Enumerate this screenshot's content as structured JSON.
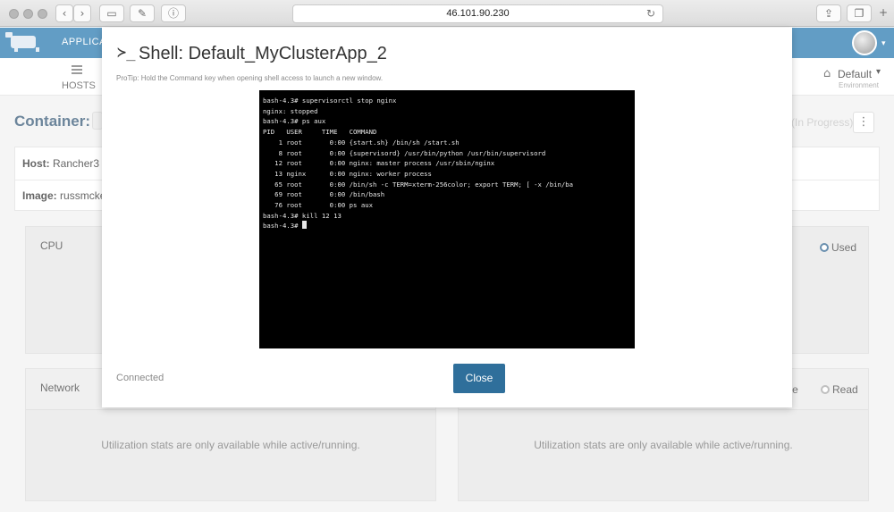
{
  "browser": {
    "url": "46.101.90.230",
    "buttons": {
      "back": "‹",
      "forward": "›",
      "sidebar": "▭",
      "pin": "✎",
      "reader": "ⓘ",
      "reload": "↻",
      "share": "⇪",
      "tabs": "❐",
      "new_tab": "+"
    }
  },
  "app": {
    "nav": {
      "applications_label": "APPLICAT"
    },
    "subnav": {
      "hosts_label": "HOSTS",
      "environment_name": "Default",
      "environment_caption": "Environment"
    },
    "container_label": "Container:",
    "state_text": "(In Progress)",
    "info": {
      "host_label": "Host:",
      "host_value": "Rancher3",
      "image_label": "Image:",
      "image_value": "russmcker"
    },
    "cpu_panel": {
      "title": "CPU",
      "used_label": "Used"
    },
    "network_panel": {
      "title": "Network",
      "message": "Utilization stats are only available while active/running."
    },
    "storage_panel": {
      "write_label": "Write",
      "read_label": "Read",
      "message": "Utilization stats are only available while active/running."
    }
  },
  "modal": {
    "icon": "≻_",
    "title": "Shell: Default_MyClusterApp_2",
    "protip": "ProTip: Hold the Command key when opening shell access to launch a new window.",
    "terminal_lines": [
      "bash-4.3# supervisorctl stop nginx",
      "nginx: stopped",
      "bash-4.3# ps aux",
      "PID   USER     TIME   COMMAND",
      "    1 root       0:00 {start.sh} /bin/sh /start.sh",
      "    8 root       0:00 {supervisord} /usr/bin/python /usr/bin/supervisord",
      "   12 root       0:00 nginx: master process /usr/sbin/nginx",
      "   13 nginx      0:00 nginx: worker process",
      "   65 root       0:00 /bin/sh -c TERM=xterm-256color; export TERM; [ -x /bin/ba",
      "   69 root       0:00 /bin/bash",
      "   76 root       0:00 ps aux",
      "bash-4.3# kill 12 13",
      "bash-4.3# "
    ],
    "status": "Connected",
    "close_label": "Close"
  }
}
